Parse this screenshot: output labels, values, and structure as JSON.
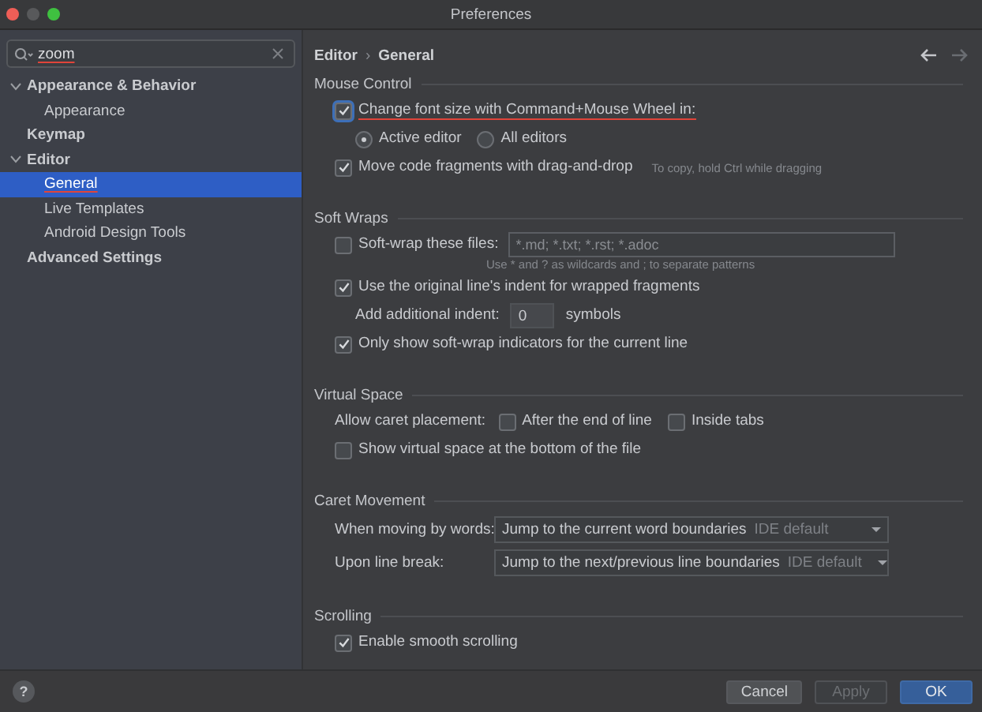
{
  "window": {
    "title": "Preferences"
  },
  "search": {
    "value": "zoom",
    "underlined": true
  },
  "sidebar": {
    "items": [
      {
        "label": "Appearance & Behavior",
        "expanded": true,
        "selected": false,
        "match": false,
        "children": [
          {
            "label": "Appearance",
            "selected": false,
            "match": false
          }
        ]
      },
      {
        "label": "Keymap",
        "selected": false,
        "match": false
      },
      {
        "label": "Editor",
        "expanded": true,
        "selected": false,
        "match": false,
        "children": [
          {
            "label": "General",
            "selected": true,
            "match": true
          },
          {
            "label": "Live Templates",
            "selected": false,
            "match": false
          },
          {
            "label": "Android Design Tools",
            "selected": false,
            "match": false
          }
        ]
      },
      {
        "label": "Advanced Settings",
        "selected": false,
        "match": false
      }
    ]
  },
  "breadcrumb": [
    "Editor",
    "›",
    "General"
  ],
  "sections": [
    {
      "title": "Mouse Control",
      "rows": [
        {
          "kind": "checkbox",
          "label": "Change font size with Command+Mouse Wheel in:",
          "checked": true,
          "focused": true,
          "match": true
        },
        {
          "kind": "radios",
          "options": [
            {
              "label": "Active editor",
              "selected": true
            },
            {
              "label": "All editors",
              "selected": false
            }
          ]
        },
        {
          "kind": "checkbox",
          "label": "Move code fragments with drag-and-drop",
          "checked": true,
          "focused": false,
          "match": false,
          "hint": "To copy, hold Ctrl while dragging"
        }
      ]
    },
    {
      "title": "Soft Wraps",
      "rows": [
        {
          "kind": "checkbox-field",
          "label": "Soft-wrap these files:",
          "checked": false,
          "placeholder": "*.md; *.txt; *.rst; *.adoc",
          "hint": "Use * and ? as wildcards and ; to separate patterns"
        },
        {
          "kind": "checkbox",
          "label": "Use the original line's indent for wrapped fragments",
          "checked": true,
          "focused": false,
          "match": false
        },
        {
          "kind": "number",
          "label": "Add additional indent:",
          "value": "0",
          "unit": "symbols"
        },
        {
          "kind": "checkbox",
          "label": "Only show soft-wrap indicators for the current line",
          "checked": true,
          "focused": false,
          "match": false
        }
      ]
    },
    {
      "title": "Virtual Space",
      "rows": [
        {
          "kind": "inline-checks",
          "label": "Allow caret placement:",
          "options": [
            {
              "label": "After the end of line",
              "checked": false
            },
            {
              "label": "Inside tabs",
              "checked": false
            }
          ]
        },
        {
          "kind": "checkbox",
          "label": "Show virtual space at the bottom of the file",
          "checked": false,
          "focused": false,
          "match": false
        }
      ]
    },
    {
      "title": "Caret Movement",
      "rows": [
        {
          "kind": "select",
          "label": "When moving by words:",
          "value": "Jump to the current word boundaries",
          "note": "IDE default"
        },
        {
          "kind": "select",
          "label": "Upon line break:",
          "value": "Jump to the next/previous line boundaries",
          "note": "IDE default"
        }
      ]
    },
    {
      "title": "Scrolling",
      "rows": [
        {
          "kind": "checkbox",
          "label": "Enable smooth scrolling",
          "checked": true,
          "focused": false,
          "match": false
        }
      ]
    }
  ],
  "help": "?",
  "buttons": [
    {
      "label": "Cancel",
      "kind": "normal"
    },
    {
      "label": "Apply",
      "kind": "disabled"
    },
    {
      "label": "OK",
      "kind": "default"
    }
  ]
}
